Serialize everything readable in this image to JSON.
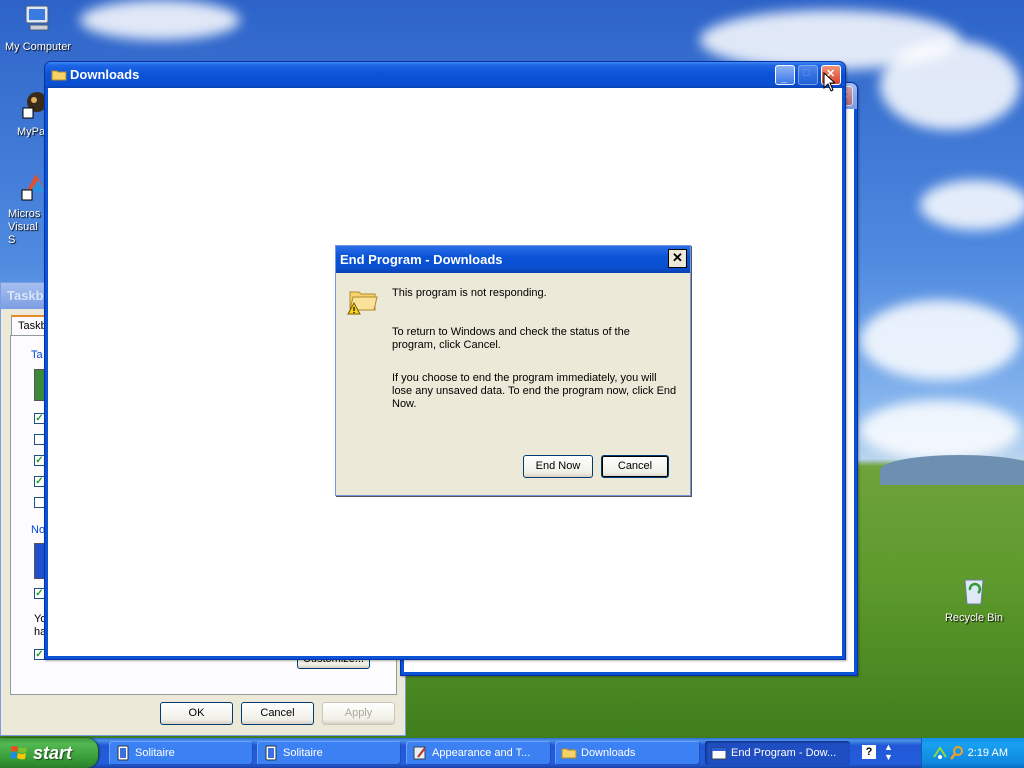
{
  "desktop_icons": [
    {
      "label": "My Computer",
      "icon": "computer-icon"
    },
    {
      "label": "MyPa",
      "icon": "shortcut-icon"
    },
    {
      "label": "Micros Visual S",
      "icon": "visual-studio-icon"
    },
    {
      "label": "Recycle Bin",
      "icon": "recycle-bin-icon"
    }
  ],
  "downloads_window": {
    "title": "Downloads"
  },
  "taskbar_props_window": {
    "title": "Taskb",
    "tab": "Taskb",
    "group1_label": "Ta",
    "group2_label": "No",
    "note": "Yo ha",
    "customize_button": "Customize...",
    "ok_button": "OK",
    "cancel_button": "Cancel",
    "apply_button": "Apply"
  },
  "dialog": {
    "title": "End Program - Downloads",
    "line1": "This program is not responding.",
    "line2": "To return to Windows and check the status of the program, click Cancel.",
    "line3": "If you choose to end the program immediately, you will lose any unsaved data. To end the program now, click End Now.",
    "end_now_button": "End Now",
    "cancel_button": "Cancel"
  },
  "taskbar": {
    "start_label": "start",
    "items": [
      {
        "label": "Solitaire",
        "icon": "solitaire-icon"
      },
      {
        "label": "Solitaire",
        "icon": "solitaire-icon"
      },
      {
        "label": "Appearance and T...",
        "icon": "control-panel-icon"
      },
      {
        "label": "Downloads",
        "icon": "folder-icon"
      },
      {
        "label": "End Program - Dow...",
        "icon": "window-icon"
      }
    ],
    "clock": "2:19 AM"
  },
  "colors": {
    "xp_blue": "#0a52d6",
    "dialog_face": "#ece9d8",
    "start_green": "#379b37"
  }
}
